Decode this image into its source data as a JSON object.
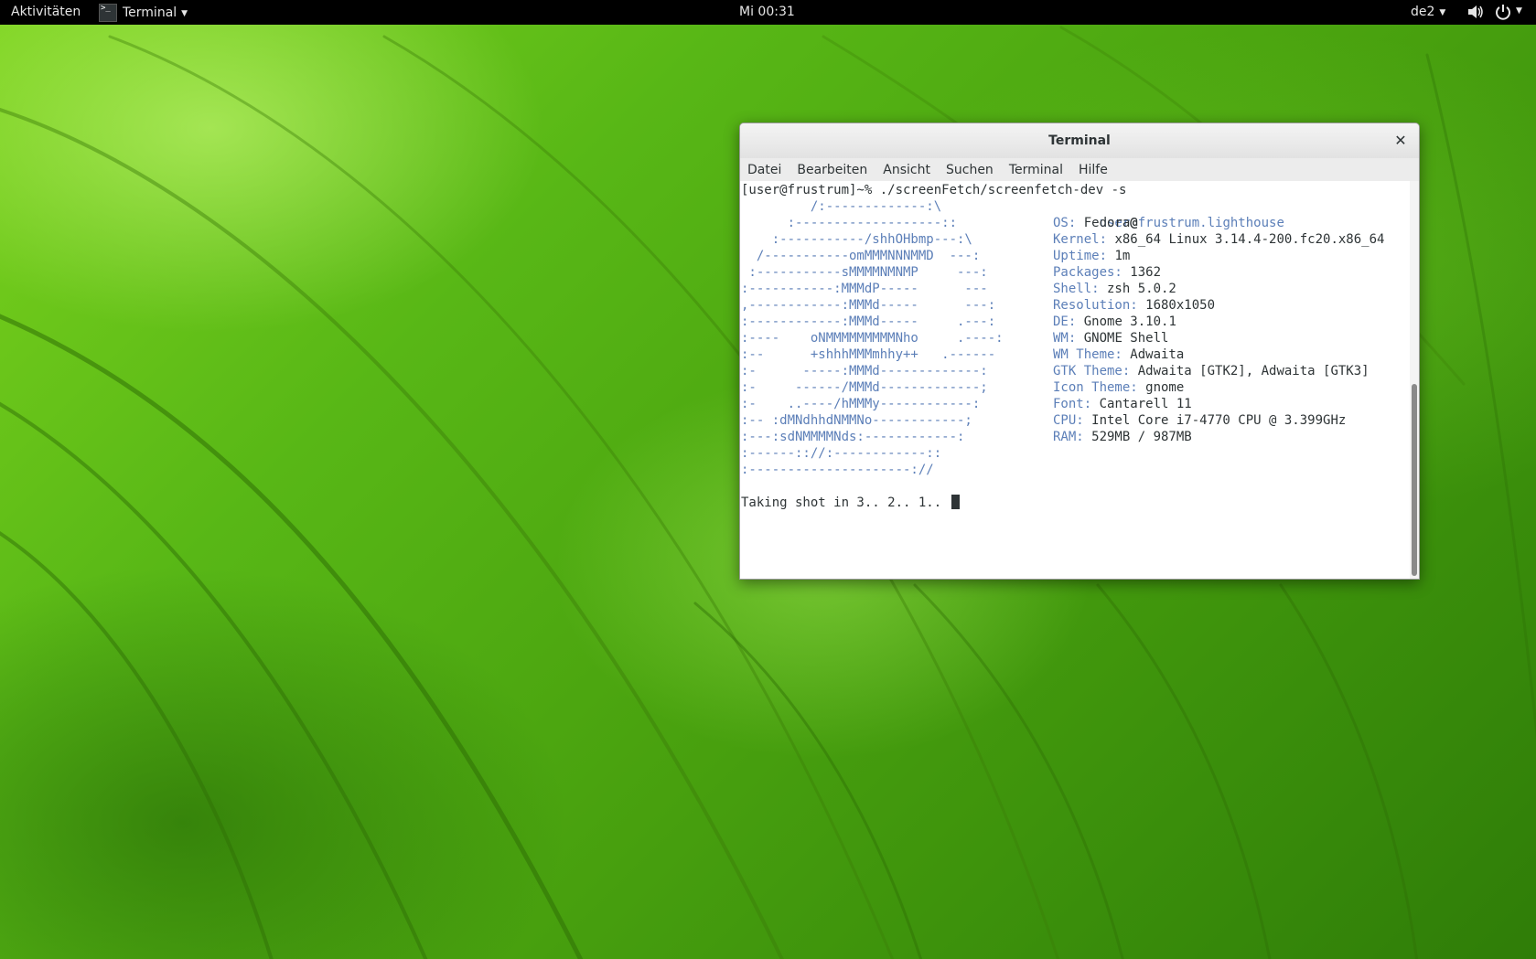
{
  "topbar": {
    "activities": "Aktivitäten",
    "app_name": "Terminal",
    "clock": "Mi 00:31",
    "language": "de2"
  },
  "window": {
    "title": "Terminal",
    "close_icon": "close-icon"
  },
  "menu": [
    "Datei",
    "Bearbeiten",
    "Ansicht",
    "Suchen",
    "Terminal",
    "Hilfe"
  ],
  "terminal": {
    "prompt": "[user@frustrum]~% ./screenFetch/screenfetch-dev -s",
    "logo": [
      "         /:-------------:\\",
      "      :-------------------::",
      "    :-----------/shhOHbmp---:\\",
      "  /-----------omMMMNNNMMD  ---:",
      " :-----------sMMMMNMNMP     ---:",
      ":-----------:MMMdP-----      ---",
      ",------------:MMMd-----      ---:",
      ":------------:MMMd-----     .---:",
      ":----    oNMMMMMMMMMNho     .----:",
      ":--      +shhhMMMmhhy++   .------",
      ":-      -----:MMMd-------------:",
      ":-     ------/MMMd-------------;",
      ":-    ..----/hMMMy------------:",
      ":-- :dMNdhhdNMMNo------------;",
      ":---:sdNMMMMNds:------------:",
      ":------:://:------------::",
      ":---------------------://"
    ],
    "user": "user",
    "at": "@",
    "host": "frustrum.lighthouse",
    "info": [
      {
        "key": "OS:",
        "value": " Fedora"
      },
      {
        "key": "Kernel:",
        "value": " x86_64 Linux 3.14.4-200.fc20.x86_64"
      },
      {
        "key": "Uptime:",
        "value": " 1m"
      },
      {
        "key": "Packages:",
        "value": " 1362"
      },
      {
        "key": "Shell:",
        "value": " zsh 5.0.2"
      },
      {
        "key": "Resolution:",
        "value": " 1680x1050"
      },
      {
        "key": "DE:",
        "value": " Gnome 3.10.1"
      },
      {
        "key": "WM:",
        "value": " GNOME Shell"
      },
      {
        "key": "WM Theme:",
        "value": " Adwaita"
      },
      {
        "key": "GTK Theme:",
        "value": " Adwaita [GTK2], Adwaita [GTK3]"
      },
      {
        "key": "Icon Theme:",
        "value": " gnome"
      },
      {
        "key": "Font:",
        "value": " Cantarell 11"
      },
      {
        "key": "CPU:",
        "value": " Intel Core i7-4770 CPU @ 3.399GHz"
      },
      {
        "key": "RAM:",
        "value": " 529MB / 987MB"
      }
    ],
    "status": "Taking shot in 3.. 2.. 1.. "
  },
  "colors": {
    "accent": "#5c7fb8",
    "wallpaper": "#4aa30f",
    "topbar": "#000000"
  }
}
